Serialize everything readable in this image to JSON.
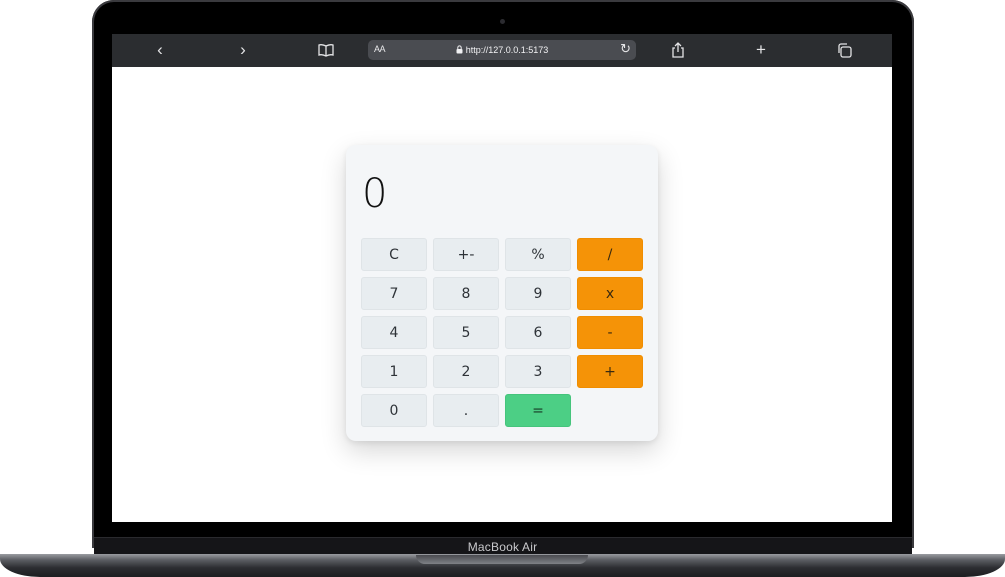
{
  "device": {
    "label": "MacBook Air"
  },
  "browser": {
    "address": {
      "text_size_label": "AA",
      "url": "http://127.0.0.1:5173"
    },
    "icons": {
      "back": "chevron-left-icon",
      "forward": "chevron-right-icon",
      "bookmarks": "book-icon",
      "lock": "lock-icon",
      "reload": "reload-icon",
      "share": "share-icon",
      "new_tab": "plus-icon",
      "tabs": "tabs-icon"
    }
  },
  "calculator": {
    "display": "0",
    "keys": [
      {
        "label": "C",
        "kind": "func"
      },
      {
        "label": "+-",
        "kind": "func"
      },
      {
        "label": "%",
        "kind": "func"
      },
      {
        "label": "/",
        "kind": "op"
      },
      {
        "label": "7",
        "kind": "digit"
      },
      {
        "label": "8",
        "kind": "digit"
      },
      {
        "label": "9",
        "kind": "digit"
      },
      {
        "label": "x",
        "kind": "op"
      },
      {
        "label": "4",
        "kind": "digit"
      },
      {
        "label": "5",
        "kind": "digit"
      },
      {
        "label": "6",
        "kind": "digit"
      },
      {
        "label": "-",
        "kind": "op"
      },
      {
        "label": "1",
        "kind": "digit"
      },
      {
        "label": "2",
        "kind": "digit"
      },
      {
        "label": "3",
        "kind": "digit"
      },
      {
        "label": "+",
        "kind": "op"
      },
      {
        "label": "0",
        "kind": "digit"
      },
      {
        "label": ".",
        "kind": "digit"
      },
      {
        "label": "=",
        "kind": "equals"
      }
    ],
    "colors": {
      "operator": "#f59307",
      "equals": "#4ccf85",
      "key": "#e8edf0",
      "panel": "#f4f6f8"
    }
  }
}
